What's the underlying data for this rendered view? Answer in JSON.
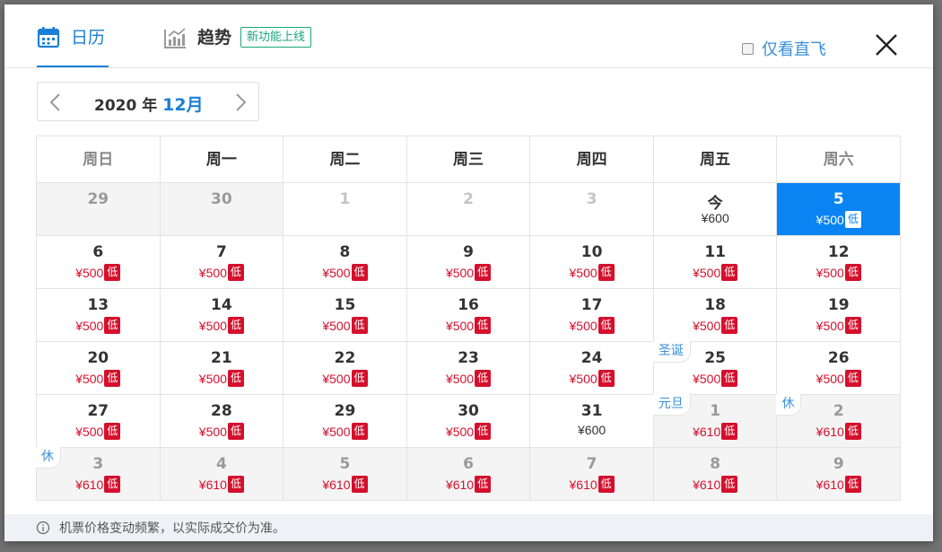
{
  "tabs": [
    {
      "label": "日历",
      "active": true,
      "icon": "calendar-icon"
    },
    {
      "label": "趋势",
      "active": false,
      "icon": "trend-chart-icon"
    }
  ],
  "new_feature_badge": "新功能上线",
  "direct_only": {
    "label": "仅看直飞",
    "checked": false
  },
  "month_nav": {
    "year": "2020",
    "year_suffix": "年",
    "month": "12月"
  },
  "weekdays": [
    "周日",
    "周一",
    "周二",
    "周三",
    "周四",
    "周五",
    "周六"
  ],
  "price_low_badge": "低",
  "weeks": [
    [
      {
        "day": "29",
        "price": "",
        "state": "other"
      },
      {
        "day": "30",
        "price": "",
        "state": "other"
      },
      {
        "day": "1",
        "price": "",
        "state": "past"
      },
      {
        "day": "2",
        "price": "",
        "state": "past"
      },
      {
        "day": "3",
        "price": "",
        "state": "past"
      },
      {
        "day": "今",
        "price": "¥600",
        "state": "today"
      },
      {
        "day": "5",
        "price": "¥500",
        "low": true,
        "state": "selected"
      }
    ],
    [
      {
        "day": "6",
        "price": "¥500",
        "low": true
      },
      {
        "day": "7",
        "price": "¥500",
        "low": true
      },
      {
        "day": "8",
        "price": "¥500",
        "low": true
      },
      {
        "day": "9",
        "price": "¥500",
        "low": true
      },
      {
        "day": "10",
        "price": "¥500",
        "low": true
      },
      {
        "day": "11",
        "price": "¥500",
        "low": true
      },
      {
        "day": "12",
        "price": "¥500",
        "low": true
      }
    ],
    [
      {
        "day": "13",
        "price": "¥500",
        "low": true
      },
      {
        "day": "14",
        "price": "¥500",
        "low": true
      },
      {
        "day": "15",
        "price": "¥500",
        "low": true
      },
      {
        "day": "16",
        "price": "¥500",
        "low": true
      },
      {
        "day": "17",
        "price": "¥500",
        "low": true
      },
      {
        "day": "18",
        "price": "¥500",
        "low": true
      },
      {
        "day": "19",
        "price": "¥500",
        "low": true
      }
    ],
    [
      {
        "day": "20",
        "price": "¥500",
        "low": true
      },
      {
        "day": "21",
        "price": "¥500",
        "low": true
      },
      {
        "day": "22",
        "price": "¥500",
        "low": true
      },
      {
        "day": "23",
        "price": "¥500",
        "low": true
      },
      {
        "day": "24",
        "price": "¥500",
        "low": true
      },
      {
        "day": "25",
        "price": "¥500",
        "low": true,
        "holiday": "圣诞"
      },
      {
        "day": "26",
        "price": "¥500",
        "low": true
      }
    ],
    [
      {
        "day": "27",
        "price": "¥500",
        "low": true
      },
      {
        "day": "28",
        "price": "¥500",
        "low": true
      },
      {
        "day": "29",
        "price": "¥500",
        "low": true
      },
      {
        "day": "30",
        "price": "¥500",
        "low": true
      },
      {
        "day": "31",
        "price": "¥600",
        "state": "today-like"
      },
      {
        "day": "1",
        "price": "¥610",
        "low": true,
        "state": "other",
        "holiday": "元旦"
      },
      {
        "day": "2",
        "price": "¥610",
        "low": true,
        "state": "other",
        "holiday": "休"
      }
    ],
    [
      {
        "day": "3",
        "price": "¥610",
        "low": true,
        "state": "other",
        "holiday": "休"
      },
      {
        "day": "4",
        "price": "¥610",
        "low": true,
        "state": "other"
      },
      {
        "day": "5",
        "price": "¥610",
        "low": true,
        "state": "other"
      },
      {
        "day": "6",
        "price": "¥610",
        "low": true,
        "state": "other"
      },
      {
        "day": "7",
        "price": "¥610",
        "low": true,
        "state": "other"
      },
      {
        "day": "8",
        "price": "¥610",
        "low": true,
        "state": "other"
      },
      {
        "day": "9",
        "price": "¥610",
        "low": true,
        "state": "other"
      }
    ]
  ],
  "footer_note": "机票价格变动频繁，以实际成交价为准。",
  "colors": {
    "accent": "#1a7fd6",
    "price_red": "#d5102c",
    "selected_bg": "#0a84f3",
    "badge_green": "#18a77a"
  }
}
